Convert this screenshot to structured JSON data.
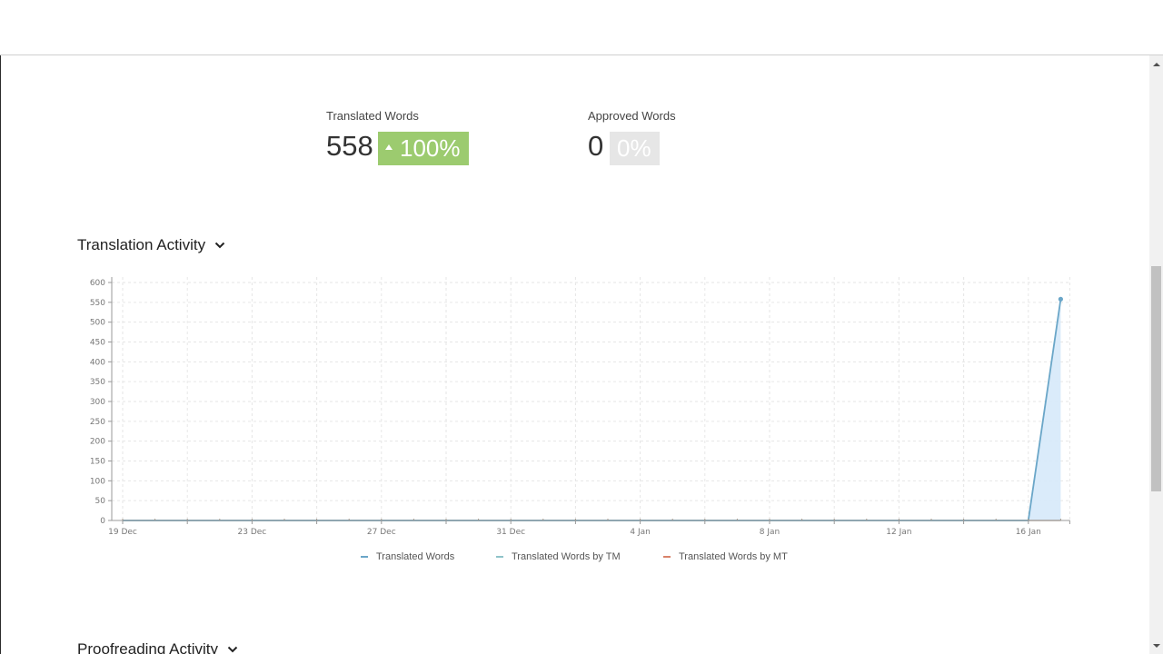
{
  "stats": {
    "translated": {
      "label": "Translated Words",
      "value": "558",
      "change": "100%"
    },
    "approved": {
      "label": "Approved Words",
      "value": "0",
      "change": "0%"
    }
  },
  "sections": {
    "translation_activity": "Translation Activity",
    "proofreading_activity": "Proofreading Activity"
  },
  "icons": {
    "section_toggle": "chevron-down-icon",
    "trend": "triangle-up-icon"
  },
  "colors": {
    "badge_up": "#9ccb6f",
    "badge_flat": "#e6e6e6",
    "series_translated": "#6aa6c8",
    "series_tm": "#8fc3c9",
    "series_mt": "#d9826a",
    "area_fill": "#d6e9f9"
  },
  "chart_data": {
    "type": "area",
    "x_tick_labels": [
      "19 Dec",
      "23 Dec",
      "27 Dec",
      "31 Dec",
      "4 Jan",
      "8 Jan",
      "12 Jan",
      "16 Jan"
    ],
    "y_tick_labels": [
      "0",
      "50",
      "100",
      "150",
      "200",
      "250",
      "300",
      "350",
      "400",
      "450",
      "500",
      "550",
      "600"
    ],
    "ylim": [
      0,
      610
    ],
    "x": [
      "19 Dec",
      "20 Dec",
      "21 Dec",
      "22 Dec",
      "23 Dec",
      "24 Dec",
      "25 Dec",
      "26 Dec",
      "27 Dec",
      "28 Dec",
      "29 Dec",
      "30 Dec",
      "31 Dec",
      "1 Jan",
      "2 Jan",
      "3 Jan",
      "4 Jan",
      "5 Jan",
      "6 Jan",
      "7 Jan",
      "8 Jan",
      "9 Jan",
      "10 Jan",
      "11 Jan",
      "12 Jan",
      "13 Jan",
      "14 Jan",
      "15 Jan",
      "16 Jan",
      "17 Jan"
    ],
    "series": [
      {
        "name": "Translated Words",
        "values": [
          0,
          0,
          0,
          0,
          0,
          0,
          0,
          0,
          0,
          0,
          0,
          0,
          0,
          0,
          0,
          0,
          0,
          0,
          0,
          0,
          0,
          0,
          0,
          0,
          0,
          0,
          0,
          0,
          0,
          558
        ]
      },
      {
        "name": "Translated Words by TM",
        "values": [
          0,
          0,
          0,
          0,
          0,
          0,
          0,
          0,
          0,
          0,
          0,
          0,
          0,
          0,
          0,
          0,
          0,
          0,
          0,
          0,
          0,
          0,
          0,
          0,
          0,
          0,
          0,
          0,
          0,
          0
        ]
      },
      {
        "name": "Translated Words by MT",
        "values": [
          0,
          0,
          0,
          0,
          0,
          0,
          0,
          0,
          0,
          0,
          0,
          0,
          0,
          0,
          0,
          0,
          0,
          0,
          0,
          0,
          0,
          0,
          0,
          0,
          0,
          0,
          0,
          0,
          0,
          0
        ]
      }
    ],
    "grid": true,
    "legend_position": "bottom-center"
  }
}
